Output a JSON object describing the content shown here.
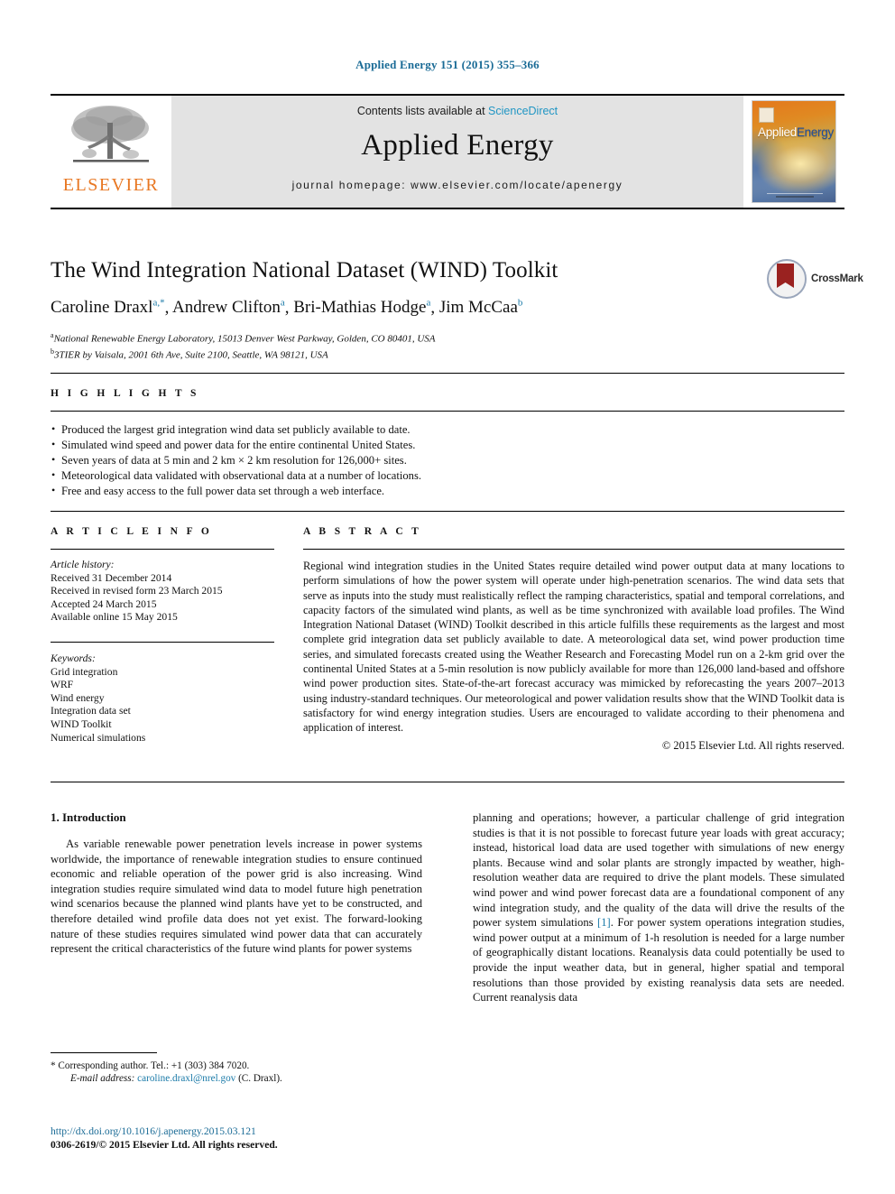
{
  "running_head": "Applied Energy 151 (2015) 355–366",
  "masthead": {
    "publisher_logo_label": "ELSEVIER",
    "contents_prefix": "Contents lists available at ",
    "contents_link": "ScienceDirect",
    "journal_name": "Applied Energy",
    "homepage_line": "journal homepage: www.elsevier.com/locate/apenergy",
    "cover_title_a": "Applied",
    "cover_title_b": "Energy"
  },
  "article": {
    "title": "The Wind Integration National Dataset (WIND) Toolkit",
    "authors": [
      {
        "name": "Caroline Draxl",
        "sup": "a,*"
      },
      {
        "name": "Andrew Clifton",
        "sup": "a"
      },
      {
        "name": "Bri-Mathias Hodge",
        "sup": "a"
      },
      {
        "name": "Jim McCaa",
        "sup": "b"
      }
    ],
    "affiliations": [
      {
        "mark": "a",
        "text": "National Renewable Energy Laboratory, 15013 Denver West Parkway, Golden, CO 80401, USA"
      },
      {
        "mark": "b",
        "text": "3TIER by Vaisala, 2001 6th Ave, Suite 2100, Seattle, WA 98121, USA"
      }
    ],
    "crossmark_label": "CrossMark"
  },
  "highlights": {
    "heading": "H I G H L I G H T S",
    "items": [
      "Produced the largest grid integration wind data set publicly available to date.",
      "Simulated wind speed and power data for the entire continental United States.",
      "Seven years of data at 5 min and 2 km × 2 km resolution for 126,000+ sites.",
      "Meteorological data validated with observational data at a number of locations.",
      "Free and easy access to the full power data set through a web interface."
    ]
  },
  "article_info": {
    "heading": "A R T I C L E    I N F O",
    "history_label": "Article history:",
    "history": [
      "Received 31 December 2014",
      "Received in revised form 23 March 2015",
      "Accepted 24 March 2015",
      "Available online 15 May 2015"
    ],
    "keywords_label": "Keywords:",
    "keywords": [
      "Grid integration",
      "WRF",
      "Wind energy",
      "Integration data set",
      "WIND Toolkit",
      "Numerical simulations"
    ]
  },
  "abstract": {
    "heading": "A B S T R A C T",
    "text": "Regional wind integration studies in the United States require detailed wind power output data at many locations to perform simulations of how the power system will operate under high-penetration scenarios. The wind data sets that serve as inputs into the study must realistically reflect the ramping characteristics, spatial and temporal correlations, and capacity factors of the simulated wind plants, as well as be time synchronized with available load profiles. The Wind Integration National Dataset (WIND) Toolkit described in this article fulfills these requirements as the largest and most complete grid integration data set publicly available to date. A meteorological data set, wind power production time series, and simulated forecasts created using the Weather Research and Forecasting Model run on a 2-km grid over the continental United States at a 5-min resolution is now publicly available for more than 126,000 land-based and offshore wind power production sites. State-of-the-art forecast accuracy was mimicked by reforecasting the years 2007–2013 using industry-standard techniques. Our meteorological and power validation results show that the WIND Toolkit data is satisfactory for wind energy integration studies. Users are encouraged to validate according to their phenomena and application of interest.",
    "copyright": "© 2015 Elsevier Ltd. All rights reserved."
  },
  "body": {
    "section_heading": "1. Introduction",
    "left_paragraph": "As variable renewable power penetration levels increase in power systems worldwide, the importance of renewable integration studies to ensure continued economic and reliable operation of the power grid is also increasing. Wind integration studies require simulated wind data to model future high penetration wind scenarios because the planned wind plants have yet to be constructed, and therefore detailed wind profile data does not yet exist. The forward-looking nature of these studies requires simulated wind power data that can accurately represent the critical characteristics of the future wind plants for power systems",
    "right_paragraph_part1": "planning and operations; however, a particular challenge of grid integration studies is that it is not possible to forecast future year loads with great accuracy; instead, historical load data are used together with simulations of new energy plants. Because wind and solar plants are strongly impacted by weather, high-resolution weather data are required to drive the plant models. These simulated wind power and wind power forecast data are a foundational component of any wind integration study, and the quality of the data will drive the results of the power system simulations ",
    "right_citation": "[1]",
    "right_paragraph_part2": ". For power system operations integration studies, wind power output at a minimum of 1-h resolution is needed for a large number of geographically distant locations. Reanalysis data could potentially be used to provide the input weather data, but in general, higher spatial and temporal resolutions than those provided by existing reanalysis data sets are needed. Current reanalysis data"
  },
  "footer": {
    "corresponding_marker": "*",
    "corresponding_text": "Corresponding author. Tel.: +1 (303) 384 7020.",
    "email_label": "E-mail address:",
    "email": "caroline.draxl@nrel.gov",
    "email_suffix": "(C. Draxl).",
    "doi": "http://dx.doi.org/10.1016/j.apenergy.2015.03.121",
    "issn_line": "0306-2619/© 2015 Elsevier Ltd. All rights reserved."
  }
}
